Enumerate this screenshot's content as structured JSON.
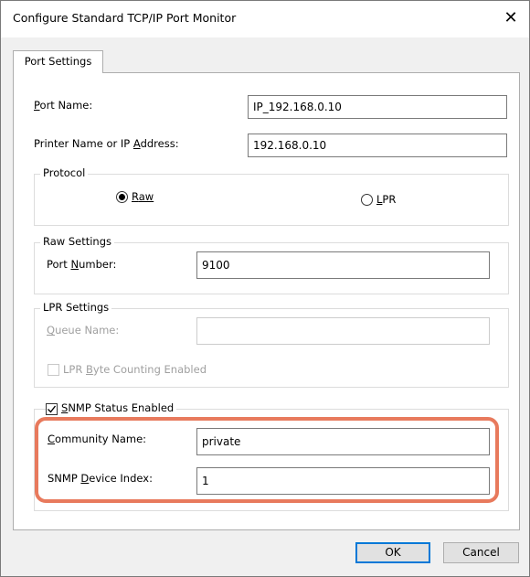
{
  "window": {
    "title": "Configure Standard TCP/IP Port Monitor",
    "close_glyph": "✕"
  },
  "tabs": [
    {
      "label": "Port Settings",
      "selected": true
    }
  ],
  "fields": {
    "port_name": {
      "label_pre": "",
      "label_key": "P",
      "label_post": "ort Name:",
      "value": "IP_192.168.0.10"
    },
    "printer_address": {
      "label_pre": "Printer Name or IP ",
      "label_key": "A",
      "label_post": "ddress:",
      "value": "192.168.0.10"
    }
  },
  "protocol": {
    "title": "Protocol",
    "options": [
      {
        "label_key": "R",
        "label_post": "aw",
        "selected": true
      },
      {
        "label_key": "L",
        "label_post": "PR",
        "selected": false
      }
    ]
  },
  "raw_settings": {
    "title": "Raw Settings",
    "port_number": {
      "label_pre": "Port ",
      "label_key": "N",
      "label_post": "umber:",
      "value": "9100"
    }
  },
  "lpr_settings": {
    "title": "LPR Settings",
    "queue_name": {
      "label_pre": "",
      "label_key": "Q",
      "label_post": "ueue Name:",
      "value": ""
    },
    "byte_counting": {
      "label_pre": "LPR ",
      "label_key": "B",
      "label_post": "yte Counting Enabled",
      "checked": false
    }
  },
  "snmp": {
    "title_pre": "",
    "title_key": "S",
    "title_post": "NMP Status Enabled",
    "checked": true,
    "community_name": {
      "label_pre": "",
      "label_key": "C",
      "label_post": "ommunity Name:",
      "value": "private"
    },
    "device_index": {
      "label_pre": "SNMP ",
      "label_key": "D",
      "label_post": "evice Index:",
      "value": "1"
    }
  },
  "buttons": {
    "ok": "OK",
    "cancel": "Cancel"
  },
  "colors": {
    "highlight": "#e87a5d",
    "default_button_border": "#0078d7"
  }
}
